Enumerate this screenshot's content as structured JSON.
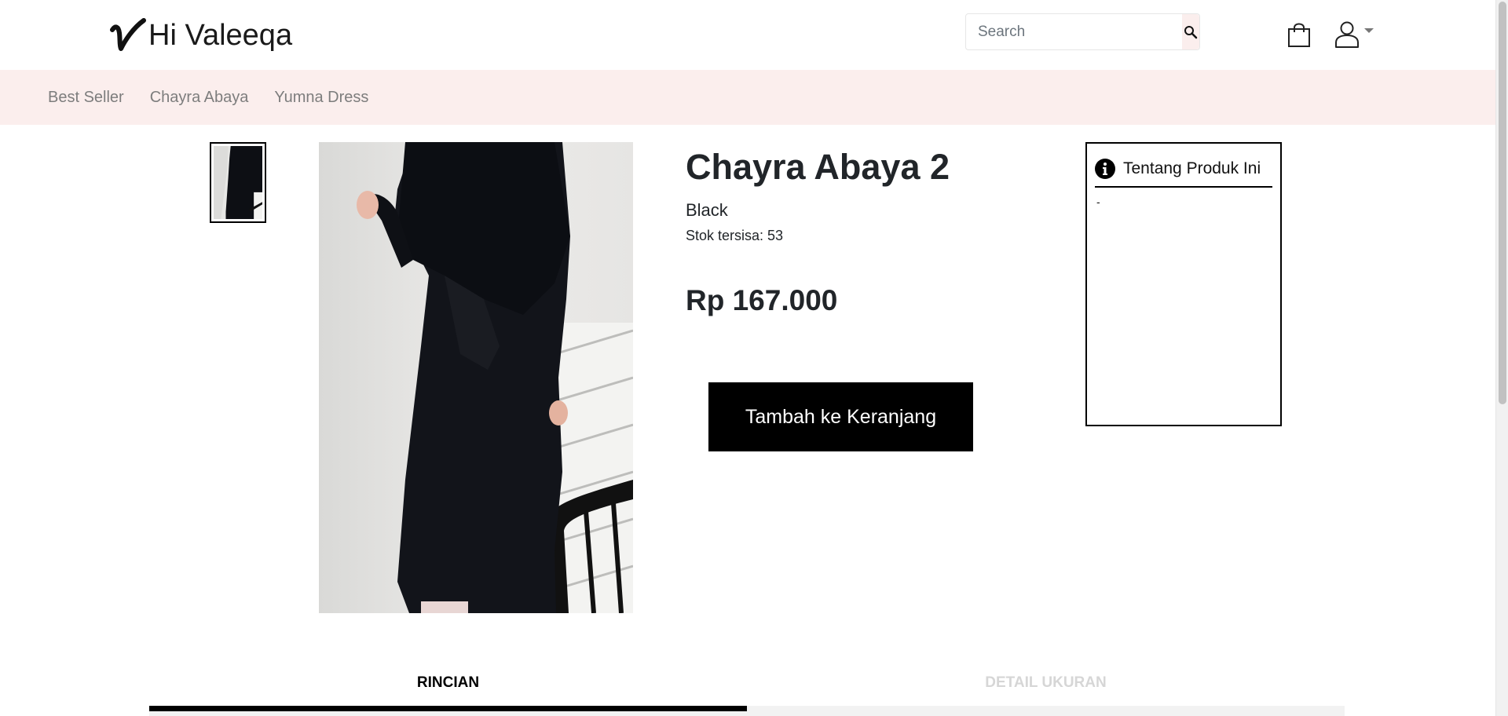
{
  "header": {
    "brand": "Hi Valeeqa",
    "search_placeholder": "Search",
    "icons": [
      "search-icon",
      "shopping-bag-icon",
      "user-icon",
      "caret-down-icon"
    ]
  },
  "categories": [
    "Best Seller",
    "Chayra Abaya",
    "Yumna Dress"
  ],
  "product": {
    "name": "Chayra Abaya 2",
    "variant": "Black",
    "stock_text": "Stok tersisa: 53",
    "price": "Rp 167.000",
    "add_to_cart": "Tambah ke Keranjang"
  },
  "about": {
    "title": "Tentang Produk Ini",
    "body": "-",
    "icon": "info-icon"
  },
  "tabs": [
    {
      "label": "RINCIAN",
      "active": true
    },
    {
      "label": "DETAIL UKURAN",
      "active": false
    }
  ],
  "colors": {
    "accent_bg": "#fbeeed",
    "button_bg": "#000000",
    "nav_text": "#7d7d7d",
    "inactive_tab": "#d6d6d6"
  }
}
